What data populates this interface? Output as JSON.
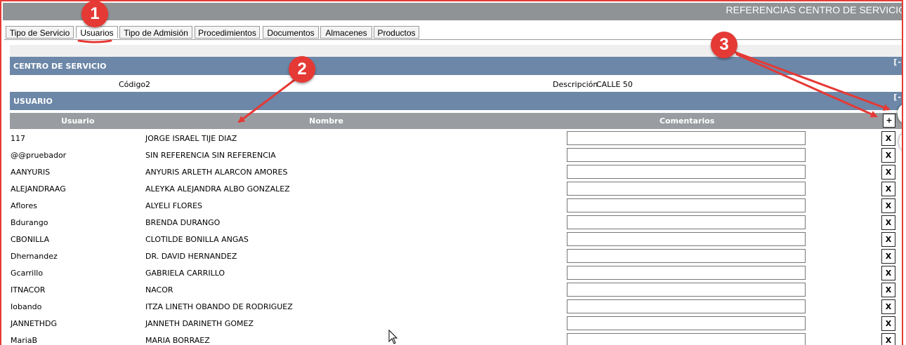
{
  "window": {
    "title": "REFERENCIAS CENTRO DE SERVICIO"
  },
  "tabs": [
    {
      "label": "Tipo de Servicio"
    },
    {
      "label": "Usuarios"
    },
    {
      "label": "Tipo de Admisión"
    },
    {
      "label": "Procedimientos"
    },
    {
      "label": "Documentos"
    },
    {
      "label": "Almacenes"
    },
    {
      "label": "Productos"
    }
  ],
  "active_tab": "Usuarios",
  "centro": {
    "header": "CENTRO DE SERVICIO",
    "collapse": "[-]",
    "codigo_label": "Código",
    "codigo_value": "2",
    "descripcion_label": "Descripción",
    "descripcion_value": "CALLE 50"
  },
  "usuario": {
    "header": "USUARIO",
    "collapse": "[-]",
    "columns": {
      "usuario": "Usuario",
      "nombre": "Nombre",
      "comentarios": "Comentarios"
    },
    "add_label": "+",
    "delete_label": "X",
    "rows": [
      {
        "usuario": "117",
        "nombre": "JORGE ISRAEL TIJE DIAZ",
        "comentario": ""
      },
      {
        "usuario": "@@pruebador",
        "nombre": "SIN REFERENCIA SIN REFERENCIA",
        "comentario": ""
      },
      {
        "usuario": "AANYURIS",
        "nombre": "ANYURIS ARLETH ALARCON AMORES",
        "comentario": ""
      },
      {
        "usuario": "ALEJANDRAAG",
        "nombre": "ALEYKA ALEJANDRA ALBO GONZALEZ",
        "comentario": ""
      },
      {
        "usuario": "Aflores",
        "nombre": "ALYELI FLORES",
        "comentario": ""
      },
      {
        "usuario": "Bdurango",
        "nombre": "BRENDA DURANGO",
        "comentario": ""
      },
      {
        "usuario": "CBONILLA",
        "nombre": "CLOTILDE BONILLA ANGAS",
        "comentario": ""
      },
      {
        "usuario": "Dhernandez",
        "nombre": "DR. DAVID HERNANDEZ",
        "comentario": ""
      },
      {
        "usuario": "Gcarrillo",
        "nombre": "GABRIELA CARRILLO",
        "comentario": ""
      },
      {
        "usuario": "ITNACOR",
        "nombre": "NACOR",
        "comentario": ""
      },
      {
        "usuario": "Iobando",
        "nombre": "ITZA LINETH OBANDO DE RODRIGUEZ",
        "comentario": ""
      },
      {
        "usuario": "JANNETHDG",
        "nombre": "JANNETH DARINETH GOMEZ",
        "comentario": ""
      },
      {
        "usuario": "MariaB",
        "nombre": "MARIA BORRAEZ",
        "comentario": ""
      }
    ]
  },
  "annotations": [
    {
      "label": "1"
    },
    {
      "label": "2"
    },
    {
      "label": "3"
    }
  ],
  "colors": {
    "annotation_red": "#e53935",
    "section_blue": "#6c87a8",
    "column_header_grey": "#999da1",
    "titlebar_grey": "#8f9396"
  }
}
